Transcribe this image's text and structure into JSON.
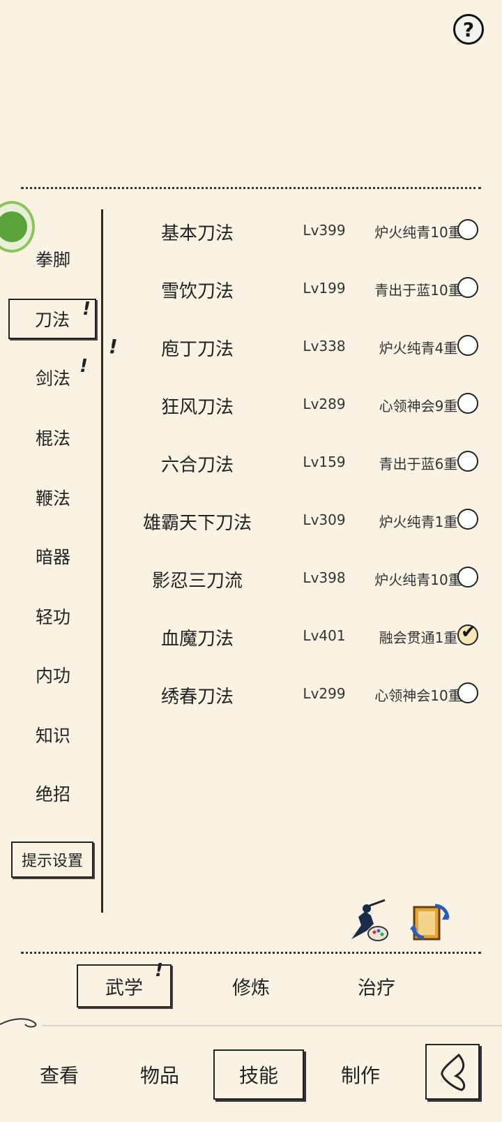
{
  "help": {
    "label": "?"
  },
  "categories": [
    {
      "label": "拳脚",
      "mark": ""
    },
    {
      "label": "刀法",
      "mark": "!"
    },
    {
      "label": "剑法",
      "mark": "!"
    },
    {
      "label": "棍法",
      "mark": ""
    },
    {
      "label": "鞭法",
      "mark": ""
    },
    {
      "label": "暗器",
      "mark": ""
    },
    {
      "label": "轻功",
      "mark": ""
    },
    {
      "label": "内功",
      "mark": ""
    },
    {
      "label": "知识",
      "mark": ""
    },
    {
      "label": "绝招",
      "mark": ""
    }
  ],
  "hint_settings_label": "提示设置",
  "row_mark": "!",
  "skills": [
    {
      "name": "基本刀法",
      "level": "Lv399",
      "rank": "炉火纯青10重",
      "checked": false
    },
    {
      "name": "雪饮刀法",
      "level": "Lv199",
      "rank": "青出于蓝10重",
      "checked": false
    },
    {
      "name": "庖丁刀法",
      "level": "Lv338",
      "rank": "炉火纯青4重",
      "checked": false
    },
    {
      "name": "狂风刀法",
      "level": "Lv289",
      "rank": "心领神会9重",
      "checked": false
    },
    {
      "name": "六合刀法",
      "level": "Lv159",
      "rank": "青出于蓝6重",
      "checked": false
    },
    {
      "name": "雄霸天下刀法",
      "level": "Lv309",
      "rank": "炉火纯青1重",
      "checked": false
    },
    {
      "name": "影忍三刀流",
      "level": "Lv398",
      "rank": "炉火纯青10重",
      "checked": false
    },
    {
      "name": "血魔刀法",
      "level": "Lv401",
      "rank": "融会贯通1重",
      "checked": true
    },
    {
      "name": "绣春刀法",
      "level": "Lv299",
      "rank": "心领神会10重",
      "checked": false
    }
  ],
  "sub_tabs": [
    {
      "label": "武学",
      "mark": "!"
    },
    {
      "label": "修炼",
      "mark": ""
    },
    {
      "label": "治疗",
      "mark": ""
    }
  ],
  "nav_tabs": [
    {
      "label": "查看"
    },
    {
      "label": "物品"
    },
    {
      "label": "技能"
    },
    {
      "label": "制作"
    }
  ],
  "icons": {
    "ninja": "ninja-palette-icon",
    "swap": "swap-scroll-icon",
    "back": "back-icon",
    "check": "✔"
  },
  "colors": {
    "background": "#faf3e4",
    "ink": "#222222",
    "avatar_green": "#8dc45a",
    "checked_fill": "#f6e6b8"
  }
}
